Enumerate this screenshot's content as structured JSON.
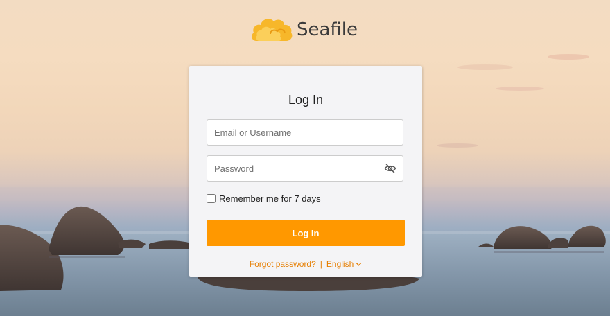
{
  "app": {
    "name": "Seafile",
    "brand_color": "#ff9800",
    "logo_icon": "cloud-logo-icon"
  },
  "login": {
    "title": "Log In",
    "username_placeholder": "Email or Username",
    "username_value": "",
    "password_placeholder": "Password",
    "password_value": "",
    "password_toggle_icon": "eye-slash-icon",
    "remember_label": "Remember me for 7 days",
    "remember_checked": false,
    "submit_label": "Log In"
  },
  "footer": {
    "forgot_password": "Forgot password?",
    "separator": "|",
    "language": "English",
    "language_icon": "chevron-down-icon"
  }
}
